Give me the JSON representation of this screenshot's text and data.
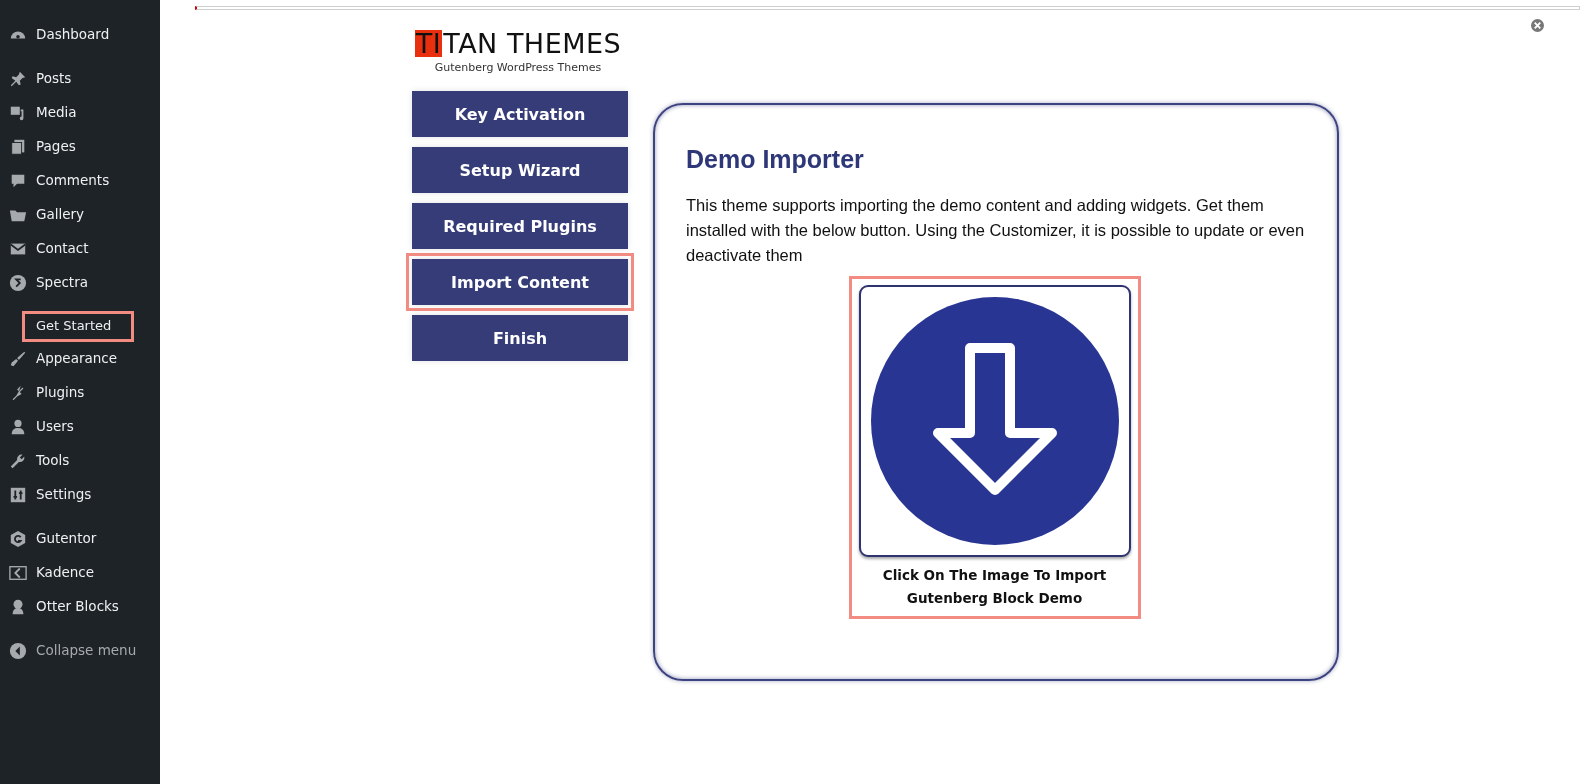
{
  "sidebar": {
    "items": [
      {
        "kind": "item",
        "label": "Dashboard",
        "highlighted": false
      },
      {
        "kind": "item",
        "label": "Posts",
        "highlighted": false
      },
      {
        "kind": "item",
        "label": "Media",
        "highlighted": false
      },
      {
        "kind": "item",
        "label": "Pages",
        "highlighted": false
      },
      {
        "kind": "item",
        "label": "Comments",
        "highlighted": false
      },
      {
        "kind": "item",
        "label": "Gallery",
        "highlighted": false
      },
      {
        "kind": "item",
        "label": "Contact",
        "highlighted": false
      },
      {
        "kind": "item",
        "label": "Spectra",
        "highlighted": false
      },
      {
        "kind": "sub",
        "label": "Get Started",
        "highlighted": true
      },
      {
        "kind": "item",
        "label": "Appearance",
        "highlighted": false
      },
      {
        "kind": "item",
        "label": "Plugins",
        "highlighted": false
      },
      {
        "kind": "item",
        "label": "Users",
        "highlighted": false
      },
      {
        "kind": "item",
        "label": "Tools",
        "highlighted": false
      },
      {
        "kind": "item",
        "label": "Settings",
        "highlighted": false
      },
      {
        "kind": "item",
        "label": "Gutentor",
        "highlighted": false
      },
      {
        "kind": "item",
        "label": "Kadence",
        "highlighted": false
      },
      {
        "kind": "item",
        "label": "Otter Blocks",
        "highlighted": false
      },
      {
        "kind": "collapse",
        "label": "Collapse menu",
        "highlighted": false
      }
    ]
  },
  "logo": {
    "mark": "TI",
    "name": "TAN THEMES",
    "tagline": "Gutenberg WordPress Themes"
  },
  "steps": [
    {
      "label": "Key Activation",
      "highlighted": false
    },
    {
      "label": "Setup Wizard",
      "highlighted": false
    },
    {
      "label": "Required Plugins",
      "highlighted": false
    },
    {
      "label": "Import Content",
      "highlighted": true
    },
    {
      "label": "Finish",
      "highlighted": false
    }
  ],
  "panel": {
    "title": "Demo Importer",
    "text": "This theme supports importing the demo content and adding widgets. Get them installed with the below button. Using the Customizer, it is possible to update or even deactivate them",
    "import": {
      "caption": "Click On The Image To Import Gutenberg Block Demo",
      "highlighted": true
    }
  }
}
